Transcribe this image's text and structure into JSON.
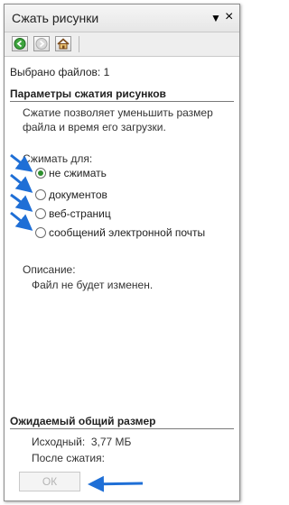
{
  "title": "Сжать рисунки",
  "title_controls": {
    "menu_glyph": "▼",
    "close_glyph": "×"
  },
  "toolbar": {
    "icons": [
      "back-icon",
      "forward-icon",
      "home-icon"
    ]
  },
  "selected_files": "Выбрано файлов: 1",
  "params": {
    "heading": "Параметры сжатия рисунков",
    "description": "Сжатие позволяет уменьшить размер файла и время его загрузки.",
    "compress_for_label": "Сжимать для:",
    "options": [
      {
        "label": "не сжимать",
        "selected": true
      },
      {
        "label": "документов",
        "selected": false
      },
      {
        "label": "веб-страниц",
        "selected": false
      },
      {
        "label": "сообщений электронной почты",
        "selected": false
      }
    ],
    "description_label": "Описание:",
    "description_text": "Файл не будет изменен."
  },
  "size": {
    "heading": "Ожидаемый общий размер",
    "original": "Исходный:  3,77 МБ",
    "after": "После сжатия:"
  },
  "ok_label": "ОК",
  "colors": {
    "accent_arrow": "#1f6fd6",
    "radio_selected": "#2d8f2d"
  }
}
